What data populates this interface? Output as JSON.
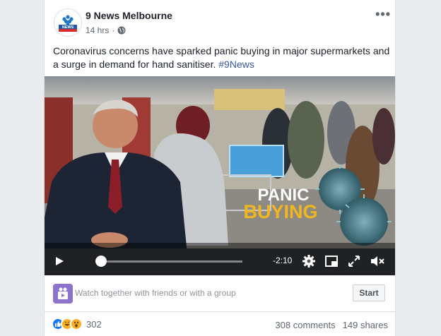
{
  "post": {
    "page_name": "9 News Melbourne",
    "logo_text": "9NEWS MELBOURNE",
    "timestamp": "14 hrs",
    "privacy_icon": "globe-icon",
    "menu_icon": "more-options-icon",
    "text_main": "Coronavirus concerns have sparked panic buying in major supermarkets and a surge in demand for hand sanitiser. ",
    "hashtag": "#9News"
  },
  "video": {
    "overlay_line1": "PANIC",
    "overlay_line2": "BUYING",
    "time_remaining": "-2:10",
    "progress": 0.04,
    "controls": [
      "play-icon",
      "settings-icon",
      "pip-icon",
      "fullscreen-icon",
      "mute-icon"
    ]
  },
  "watch_party": {
    "text": "Watch together with friends or with a group",
    "button_label": "Start"
  },
  "engagement": {
    "reaction_count": "302",
    "comments": "308 comments",
    "shares": "149 shares"
  },
  "colors": {
    "link": "#385898",
    "accent_purple": "#8c72cb",
    "overlay_yellow": "#f2b61e"
  }
}
